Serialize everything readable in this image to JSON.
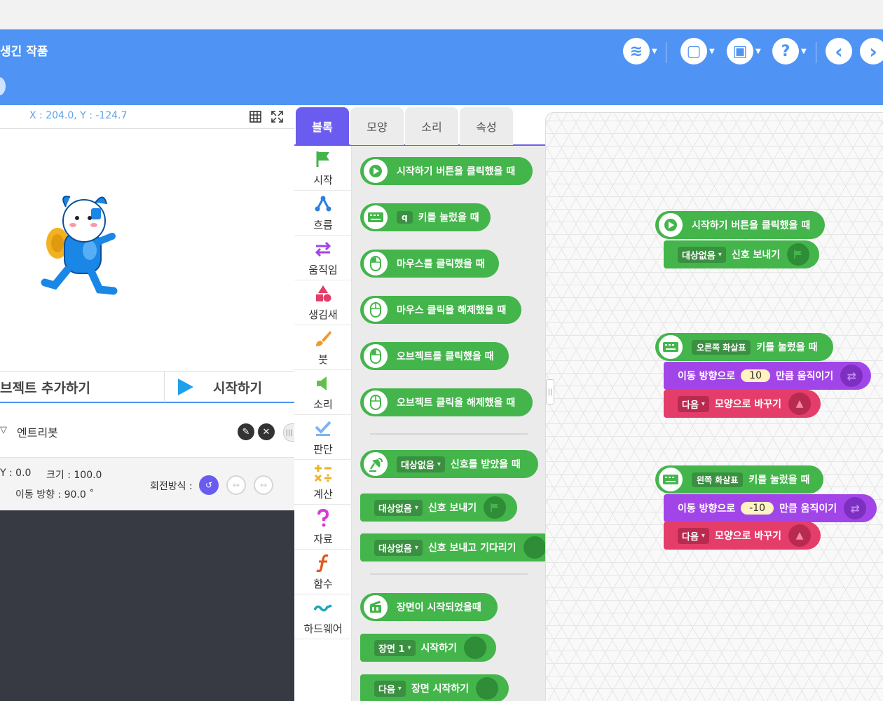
{
  "header": {
    "project_title": "생긴 작품",
    "buttons": [
      {
        "name": "mode-icon",
        "glyph": "≋"
      },
      {
        "name": "file-icon",
        "glyph": "▢"
      },
      {
        "name": "save-icon",
        "glyph": "▣"
      },
      {
        "name": "help-icon",
        "glyph": "?"
      }
    ],
    "prev_glyph": "‹",
    "next_glyph": "›"
  },
  "stage": {
    "coords": "X : 204.0, Y : -124.7",
    "add_object_label": "브젝트 추가하기",
    "start_label": "시작하기"
  },
  "object": {
    "name": "엔트리봇",
    "edit_glyph": "✎",
    "delete_glyph": "✕"
  },
  "props": {
    "y": "Y : 0.0",
    "size": "크기 : 100.0",
    "direction": "이동 방향 : 90.0 ˚",
    "rotation_label": "회전방식 :"
  },
  "tabs": [
    "블록",
    "모양",
    "소리",
    "속성"
  ],
  "categories": [
    {
      "label": "시작",
      "color": "#43b54b",
      "icon": "flag-icon"
    },
    {
      "label": "흐름",
      "color": "#2a7fe0",
      "icon": "flow-icon"
    },
    {
      "label": "움직임",
      "color": "#a245e8",
      "icon": "move-icon"
    },
    {
      "label": "생김새",
      "color": "#e53d6a",
      "icon": "looks-icon"
    },
    {
      "label": "붓",
      "color": "#f09a2a",
      "icon": "brush-icon"
    },
    {
      "label": "소리",
      "color": "#5ec24a",
      "icon": "sound-icon"
    },
    {
      "label": "판단",
      "color": "#7fb3f0",
      "icon": "judge-icon"
    },
    {
      "label": "계산",
      "color": "#f2b21f",
      "icon": "calc-icon"
    },
    {
      "label": "자료",
      "color": "#d63ad6",
      "icon": "data-icon"
    },
    {
      "label": "함수",
      "color": "#e05a1f",
      "icon": "function-icon"
    },
    {
      "label": "하드웨어",
      "color": "#1aa8b8",
      "icon": "hardware-icon"
    }
  ],
  "palette": {
    "b1": "시작하기 버튼을 클릭했을 때",
    "b2_key": "q",
    "b2": "키를 눌렀을 때",
    "b3": "마우스를 클릭했을 때",
    "b4": "마우스 클릭을 해제했을 때",
    "b5": "오브젝트를 클릭했을 때",
    "b6": "오브젝트 클릭을 해제했을 때",
    "b7_dd": "대상없음",
    "b7": "신호를 받았을 때",
    "b8_dd": "대상없음",
    "b8": "신호 보내기",
    "b9_dd": "대상없음",
    "b9": "신호 보내고 기다리기",
    "b10": "장면이 시작되었을때",
    "b11_dd": "장면 1",
    "b11": "시작하기",
    "b12_dd": "다음",
    "b12": "장면 시작하기"
  },
  "workspace": {
    "s1_hat": "시작하기 버튼을 클릭했을 때",
    "s1_dd": "대상없음",
    "s1_cmd": "신호 보내기",
    "s2_key": "오른쪽 화살표",
    "s2_hat": "키를 눌렀을 때",
    "s2_move_pre": "이동 방향으로",
    "s2_move_val": "10",
    "s2_move_post": "만큼 움직이기",
    "s2_look_dd": "다음",
    "s2_look": "모양으로 바꾸기",
    "s3_key": "왼쪽 화살표",
    "s3_hat": "키를 눌렀을 때",
    "s3_move_pre": "이동 방향으로",
    "s3_move_val": "-10",
    "s3_move_post": "만큼 움직이기",
    "s3_look_dd": "다음",
    "s3_look": "모양으로 바꾸기"
  }
}
